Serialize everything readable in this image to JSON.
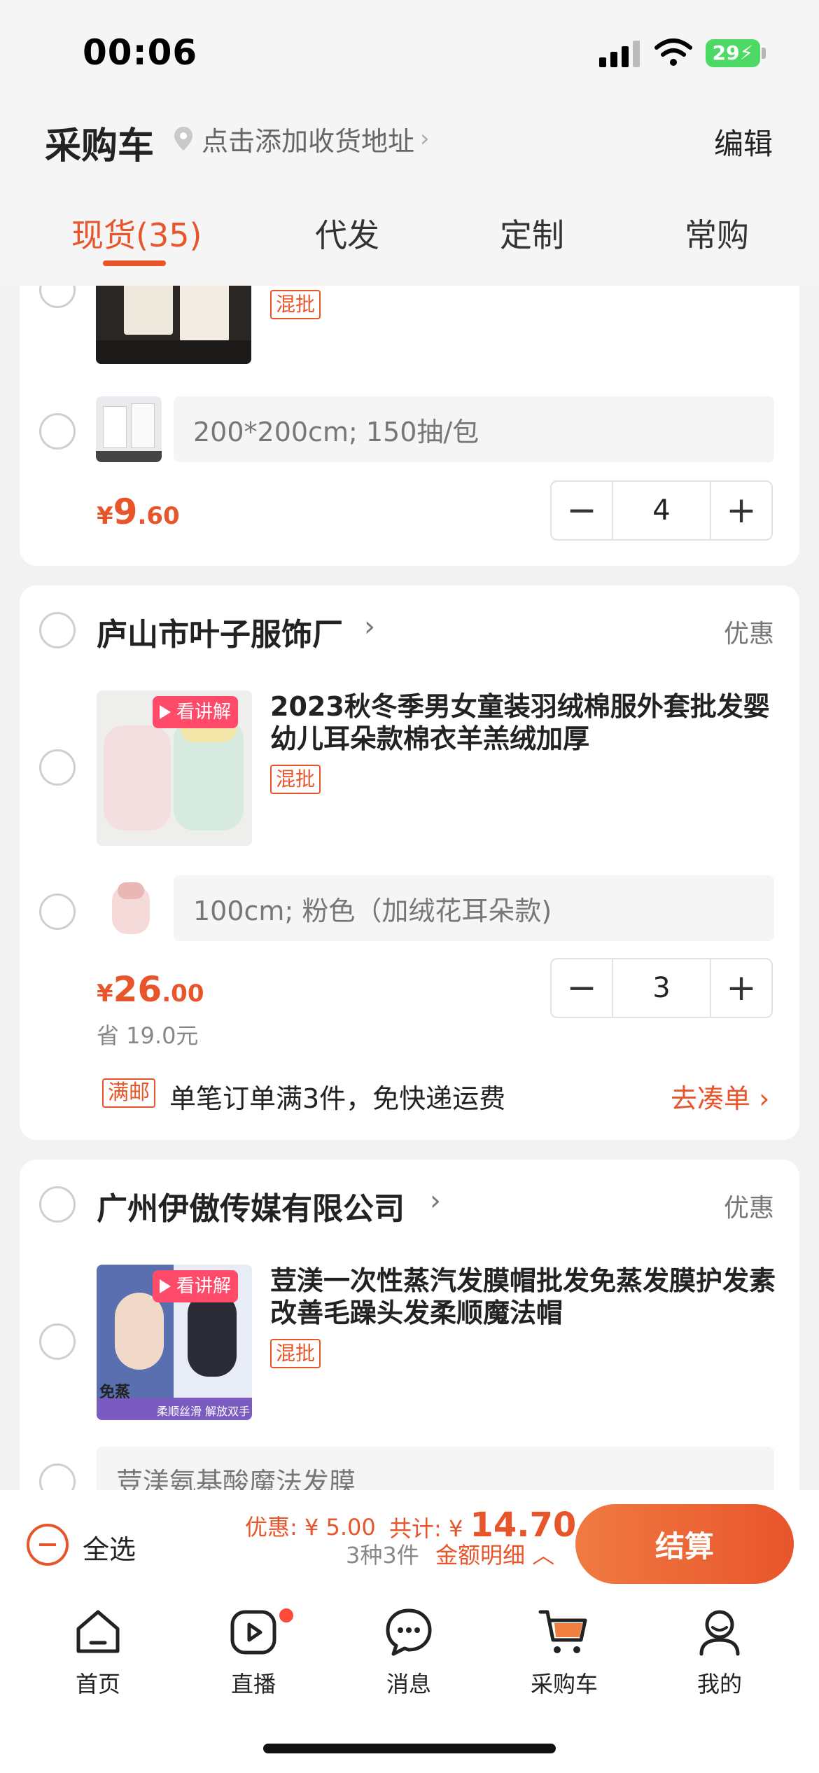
{
  "status": {
    "time": "00:06",
    "battery": "29"
  },
  "header": {
    "title": "采购车",
    "address_prompt": "点击添加收货地址",
    "edit_label": "编辑"
  },
  "tabs": [
    {
      "label": "现货(35)",
      "active": true
    },
    {
      "label": "代发",
      "active": false
    },
    {
      "label": "定制",
      "active": false
    },
    {
      "label": "常购",
      "active": false
    }
  ],
  "cards": [
    {
      "tag": "混批",
      "spec": "200*200cm; 150抽/包",
      "price_symbol": "¥",
      "price_int": "9",
      "price_dec": ".60",
      "quantity": "4"
    },
    {
      "shop_name": "庐山市叶子服饰厂",
      "promo_label": "优惠",
      "badge": "看讲解",
      "title": "2023秋冬季男女童装羽绒棉服外套批发婴幼儿耳朵款棉衣羊羔绒加厚",
      "tag": "混批",
      "spec": "100cm; 粉色（加绒花耳朵款)",
      "price_symbol": "¥",
      "price_int": "26",
      "price_dec": ".00",
      "saved": "省 19.0元",
      "quantity": "3",
      "shipping_tag": "满邮",
      "shipping_text": "单笔订单满3件，免快递运费",
      "shipping_link": "去凑单"
    },
    {
      "shop_name": "广州伊傲传媒有限公司",
      "promo_label": "优惠",
      "badge": "看讲解",
      "title": "荳渼一次性蒸汽发膜帽批发免蒸发膜护发素改善毛躁头发柔顺魔法帽",
      "tag": "混批",
      "thumb_caption_left": "免蒸",
      "thumb_caption_right": "柔顺丝滑 解放双手",
      "spec": "荳渼氨基酸魔法发膜"
    }
  ],
  "summary": {
    "select_all": "全选",
    "discount": "优惠: ¥ 5.00",
    "total_label": "共计: ¥",
    "total_amount": "14.70",
    "count": "3种3件",
    "detail": "金额明细",
    "checkout": "结算"
  },
  "nav": [
    {
      "label": "首页"
    },
    {
      "label": "直播"
    },
    {
      "label": "消息"
    },
    {
      "label": "采购车"
    },
    {
      "label": "我的"
    }
  ],
  "colors": {
    "accent": "#e8552b",
    "live_badge": "#ff4a6a",
    "battery": "#4cd964"
  }
}
